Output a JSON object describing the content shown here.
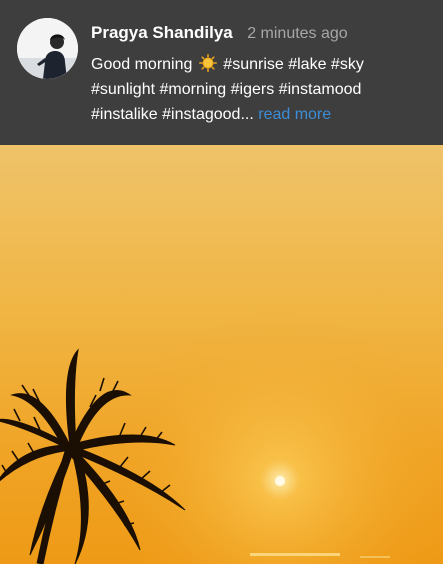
{
  "post": {
    "author": "Pragya Shandilya",
    "timestamp": "2 minutes ago",
    "caption_line1_prefix": "Good morning",
    "caption_emoji": "sun-emoji",
    "caption_line1_tags": "#sunrise #lake #sky",
    "caption_line2": "#sunlight #morning #igers #instamood",
    "caption_line3": "#instalike #instagood...",
    "read_more": "read more"
  },
  "colors": {
    "header_bg": "#3e3e3e",
    "author_text": "#ffffff",
    "timestamp_text": "#a7a7a7",
    "read_more_link": "#3c8dd6"
  }
}
